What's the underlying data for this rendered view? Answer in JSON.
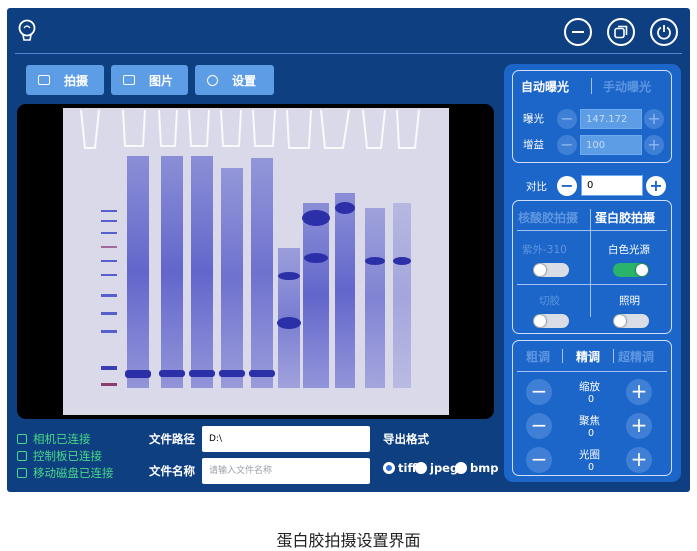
{
  "toolbar": {
    "capture_label": "拍摄",
    "pictures_label": "图片",
    "settings_label": "设置"
  },
  "status": {
    "camera": "相机已连接",
    "control_board": "控制板已连接",
    "disk": "移动磁盘已连接"
  },
  "file": {
    "path_label": "文件路径",
    "path_value": "D:\\",
    "name_label": "文件名称",
    "name_placeholder": "请输入文件名称"
  },
  "export": {
    "label": "导出格式",
    "options": [
      "tiff",
      "jpeg",
      "bmp"
    ],
    "selected": "tiff"
  },
  "exposure": {
    "auto_tab": "自动曝光",
    "manual_tab": "手动曝光",
    "exposure_label": "曝光",
    "exposure_value": "147.172",
    "gain_label": "增益",
    "gain_value": "100"
  },
  "contrast": {
    "label": "对比",
    "value": "0"
  },
  "mode": {
    "nucleic_tab": "核酸胶拍摄",
    "protein_tab": "蛋白胶拍摄",
    "uv_label": "紫外-310",
    "white_label": "白色光源",
    "uv_on": false,
    "white_on": true,
    "cut_label": "切胶",
    "light_label": "照明",
    "cut_on": false,
    "light_on": false
  },
  "tune": {
    "coarse_tab": "粗调",
    "fine_tab": "精调",
    "super_tab": "超精调",
    "zoom_label": "缩放",
    "zoom_value": "0",
    "focus_label": "聚焦",
    "focus_value": "0",
    "aperture_label": "光圈",
    "aperture_value": "0"
  },
  "caption": "蛋白胶拍摄设置界面",
  "colors": {
    "background": "#0e3f80",
    "panel": "#1c66c9",
    "button": "#5d9de6",
    "status": "#47d888",
    "switch_on": "#29b36b"
  }
}
